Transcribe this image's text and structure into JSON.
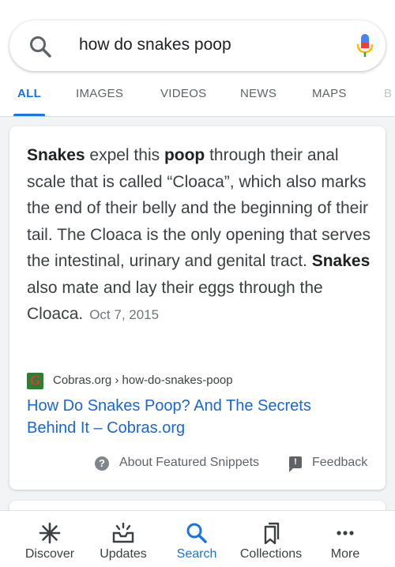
{
  "search": {
    "query": "how do snakes poop"
  },
  "tabs": [
    {
      "label": "ALL",
      "active": true
    },
    {
      "label": "IMAGES"
    },
    {
      "label": "VIDEOS"
    },
    {
      "label": "NEWS"
    },
    {
      "label": "MAPS"
    },
    {
      "label": "B"
    }
  ],
  "featured_snippet": {
    "bold_1": "Snakes",
    "text_1": " expel this ",
    "bold_2": "poop",
    "text_2": " through their anal scale that is called “Cloaca”, which also marks the end of their belly and the beginning of their tail. The Cloaca is the only opening that serves the intestinal, urinary and genital tract. ",
    "bold_3": "Snakes",
    "text_3": " also mate and lay their eggs through the Cloaca.",
    "date": "Oct 7, 2015",
    "source": "Cobras.org › how-do-snakes-poop",
    "link_title": "How Do Snakes Poop? And The Secrets Behind It – Cobras.org",
    "about_label": "About Featured Snippets",
    "feedback_label": "Feedback"
  },
  "bottom_nav": [
    {
      "label": "Discover",
      "icon": "asterisk-icon"
    },
    {
      "label": "Updates",
      "icon": "inbox-icon"
    },
    {
      "label": "Search",
      "icon": "search-icon",
      "active": true
    },
    {
      "label": "Collections",
      "icon": "bookmarks-icon"
    },
    {
      "label": "More",
      "icon": "more-dots-icon"
    }
  ],
  "colors": {
    "accent": "#1a73e8",
    "link": "#1967d2",
    "text": "#3c4043"
  }
}
